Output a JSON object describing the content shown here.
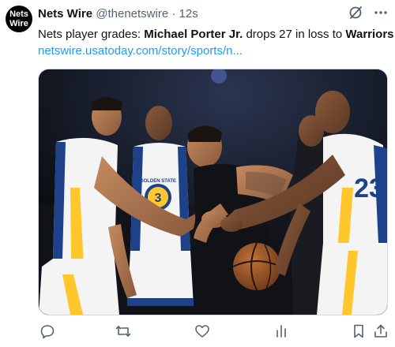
{
  "account": {
    "avatar_line1": "Nets",
    "avatar_line2": "Wire",
    "display_name": "Nets Wire",
    "handle": "@thenetswire",
    "separator": "·",
    "timestamp": "12s"
  },
  "post": {
    "text_prefix": "Nets player grades: ",
    "text_bold1": "Michael Porter Jr.",
    "text_mid": " drops 27 in loss to ",
    "text_bold2": "Warriors",
    "link": "netswire.usatoday.com/story/sports/n..."
  },
  "media": {
    "jersey_number_left": "3",
    "jersey_number_right": "23",
    "jersey_text": "GOLDEN STATE"
  },
  "header_icons": [
    "grok-icon",
    "more-icon"
  ],
  "actions": [
    "reply-icon",
    "repost-icon",
    "like-icon",
    "views-icon",
    "bookmark-icon",
    "share-icon"
  ],
  "colors": {
    "link": "#1d9bf0",
    "text": "#0f1419",
    "secondary": "#536471",
    "warriors_blue": "#1d428a",
    "warriors_gold": "#ffc72c"
  }
}
